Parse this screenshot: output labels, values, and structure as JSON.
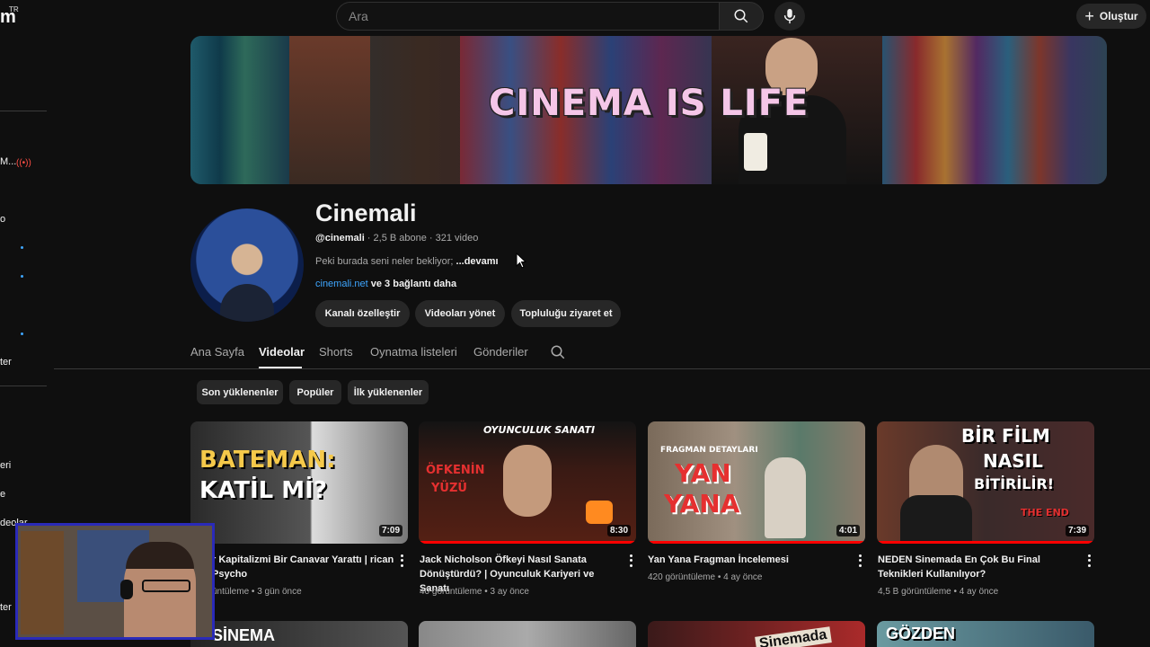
{
  "topbar": {
    "logo_fragment": "m",
    "region": "TR",
    "search_placeholder": "Ara",
    "create_label": "Oluştur"
  },
  "sidebar": {
    "fragments": [
      "M...",
      "ter",
      "eri",
      "e",
      "deolar",
      "ter"
    ]
  },
  "banner": {
    "title": "CINEMA IS LIFE"
  },
  "channel": {
    "name": "Cinemali",
    "handle": "@cinemali",
    "stats": " · 2,5 B abone · 321 video",
    "description": "Peki burada seni neler bekliyor; ",
    "more": "...devamı",
    "link": "cinemali.net",
    "more_links": " ve 3 bağlantı daha",
    "buttons": [
      "Kanalı özelleştir",
      "Videoları yönet",
      "Topluluğu ziyaret et"
    ]
  },
  "tabs": [
    "Ana Sayfa",
    "Videolar",
    "Shorts",
    "Oynatma listeleri",
    "Gönderiler"
  ],
  "active_tab": "Videolar",
  "chips": [
    "Son yüklenenler",
    "Popüler",
    "İlk yüklenenler"
  ],
  "videos": [
    {
      "thumb_text": [
        "BATEMAN:",
        "KATİL Mİ?"
      ],
      "duration": "7:09",
      "progress": 0,
      "title": "r Kapitalizmi Bir Canavar Yarattı | rican Psycho",
      "meta": "üntüleme • 3 gün önce"
    },
    {
      "thumb_text": [
        "OYUNCULUK SANATI",
        "ÖFKENİN",
        "YÜZÜ"
      ],
      "duration": "8:30",
      "progress": 1.0,
      "title": "Jack Nicholson Öfkeyi Nasıl Sanata Dönüştürdü? | Oyunculuk Kariyeri ve Sanatı",
      "meta": "40 görüntüleme • 3 ay önce"
    },
    {
      "thumb_text": [
        "FRAGMAN DETAYLARI",
        "YAN",
        "YANA"
      ],
      "duration": "4:01",
      "progress": 1.0,
      "title": "Yan Yana Fragman İncelemesi",
      "meta": "420 görüntüleme • 4 ay önce"
    },
    {
      "thumb_text": [
        "BİR FİLM",
        "NASIL",
        "BİTİRİLİR!",
        "THE END"
      ],
      "duration": "7:39",
      "progress": 1.0,
      "title": "NEDEN Sinemada En Çok Bu Final Teknikleri Kullanılıyor?",
      "meta": "4,5 B görüntüleme • 4 ay önce"
    }
  ],
  "next_row_thumbs": [
    "SİNEMA",
    "",
    "Sinemada",
    "GÖZDEN"
  ],
  "colors": {
    "background": "#0f0f0f",
    "pill": "#272727",
    "link": "#3ea6ff",
    "progress": "#ff0000",
    "cam_border": "#2a2ab8"
  }
}
